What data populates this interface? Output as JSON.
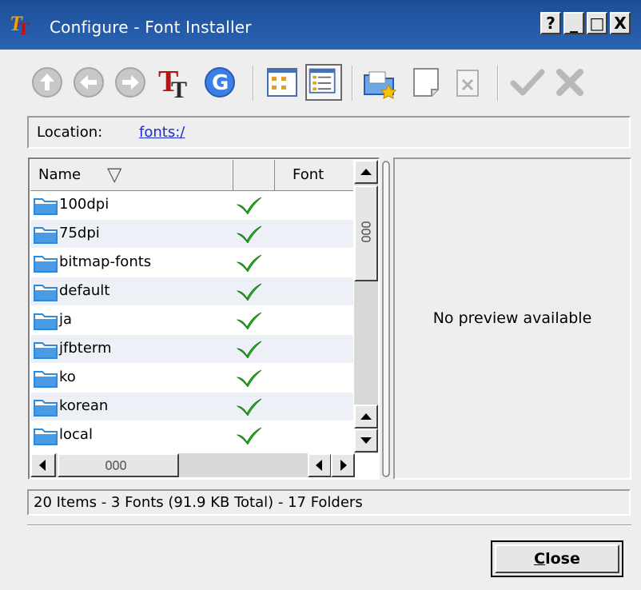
{
  "window": {
    "title": "Configure - Font Installer",
    "title_buttons": [
      "?",
      "_",
      "□",
      "X"
    ]
  },
  "toolbar": {
    "icons": [
      "up-arrow-icon",
      "back-arrow-icon",
      "forward-arrow-icon",
      "font-tt-icon",
      "refresh-g-icon",
      "icon-view-icon",
      "detail-view-icon",
      "install-fonts-icon",
      "new-folder-icon",
      "delete-icon",
      "enable-check-icon",
      "disable-x-icon"
    ]
  },
  "location": {
    "label": "Location:",
    "url": "fonts:/"
  },
  "list": {
    "columns": [
      "Name",
      "",
      "Font"
    ],
    "sort_indicator": "▽",
    "rows": [
      {
        "name": "100dpi",
        "enabled": true
      },
      {
        "name": "75dpi",
        "enabled": true
      },
      {
        "name": "bitmap-fonts",
        "enabled": true
      },
      {
        "name": "default",
        "enabled": true
      },
      {
        "name": "ja",
        "enabled": true
      },
      {
        "name": "jfbterm",
        "enabled": true
      },
      {
        "name": "ko",
        "enabled": true
      },
      {
        "name": "korean",
        "enabled": true
      },
      {
        "name": "local",
        "enabled": true
      }
    ]
  },
  "preview": {
    "text": "No preview available"
  },
  "status": {
    "text": "20 Items - 3 Fonts (91.9 KB Total) - 17 Folders"
  },
  "buttons": {
    "close_first": "C",
    "close_rest": "lose"
  },
  "colors": {
    "titlebar": "#2a64b4",
    "link": "#1a2ccc",
    "check": "#22b022",
    "folder": "#2a8ae0"
  }
}
